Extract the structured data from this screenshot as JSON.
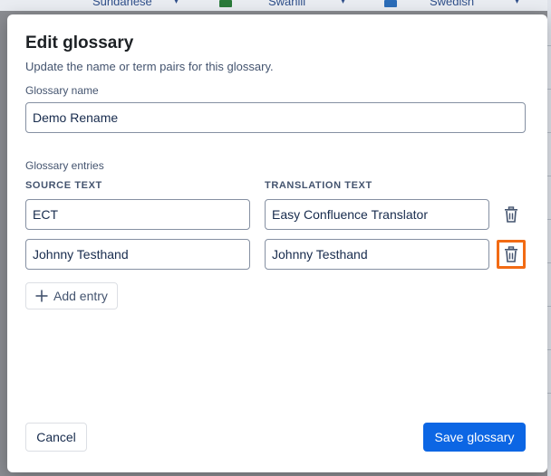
{
  "background": {
    "languages": [
      "Sundanese",
      "Swahili",
      "Swedish"
    ]
  },
  "dialog": {
    "title": "Edit glossary",
    "subtitle": "Update the name or term pairs for this glossary.",
    "name_label": "Glossary name",
    "name_value": "Demo Rename",
    "entries_label": "Glossary entries",
    "col_source": "SOURCE TEXT",
    "col_translation": "TRANSLATION TEXT",
    "entries": [
      {
        "source": "ECT",
        "translation": "Easy Confluence Translator"
      },
      {
        "source": "Johnny Testhand",
        "translation": "Johnny Testhand"
      }
    ],
    "add_entry_label": "Add entry",
    "cancel_label": "Cancel",
    "save_label": "Save glossary"
  },
  "colors": {
    "primary": "#0c66e4",
    "highlight": "#f26b14"
  },
  "icons": [
    "trash-icon",
    "plus-icon"
  ]
}
